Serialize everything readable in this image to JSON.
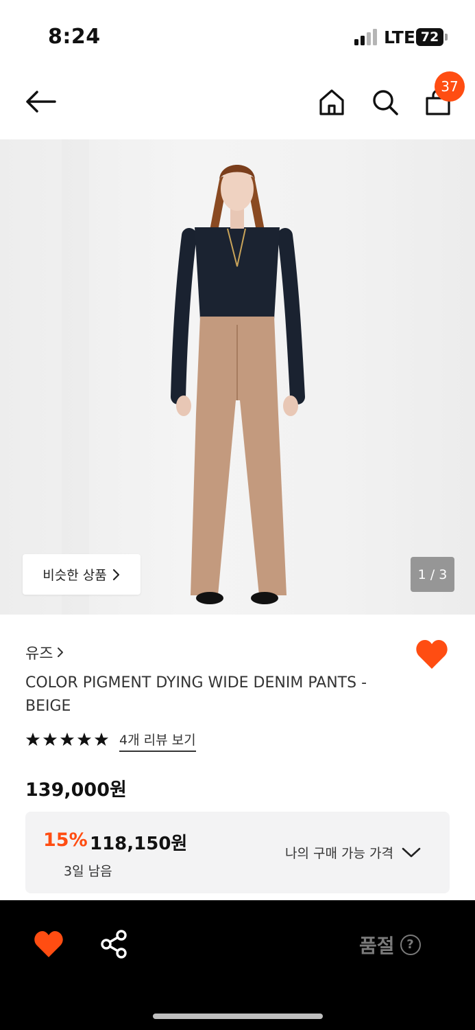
{
  "status_bar": {
    "time": "8:24",
    "network": "LTE",
    "battery": "72"
  },
  "header": {
    "cart_count": "37",
    "icons": [
      "back-arrow-icon",
      "home-icon",
      "search-icon",
      "shopping-bag-icon"
    ]
  },
  "gallery": {
    "similar_label": "비슷한 상품",
    "counter": "1 / 3"
  },
  "product": {
    "brand": "유즈",
    "name": "COLOR PIGMENT DYING WIDE DENIM PANTS - BEIGE",
    "rating_stars": 5,
    "review_link": "4개 리뷰 보기",
    "price": "139,000원",
    "discount_percent": "15%",
    "sale_price": "118,150원",
    "days_left": "3일 남음",
    "my_price_label": "나의 구매 가능 가격"
  },
  "bottom_bar": {
    "soldout_label": "품절",
    "help_symbol": "?"
  },
  "colors": {
    "accent": "#ff4d12",
    "bottom_bg": "#000000",
    "soldout_text": "#7a7a7a"
  }
}
